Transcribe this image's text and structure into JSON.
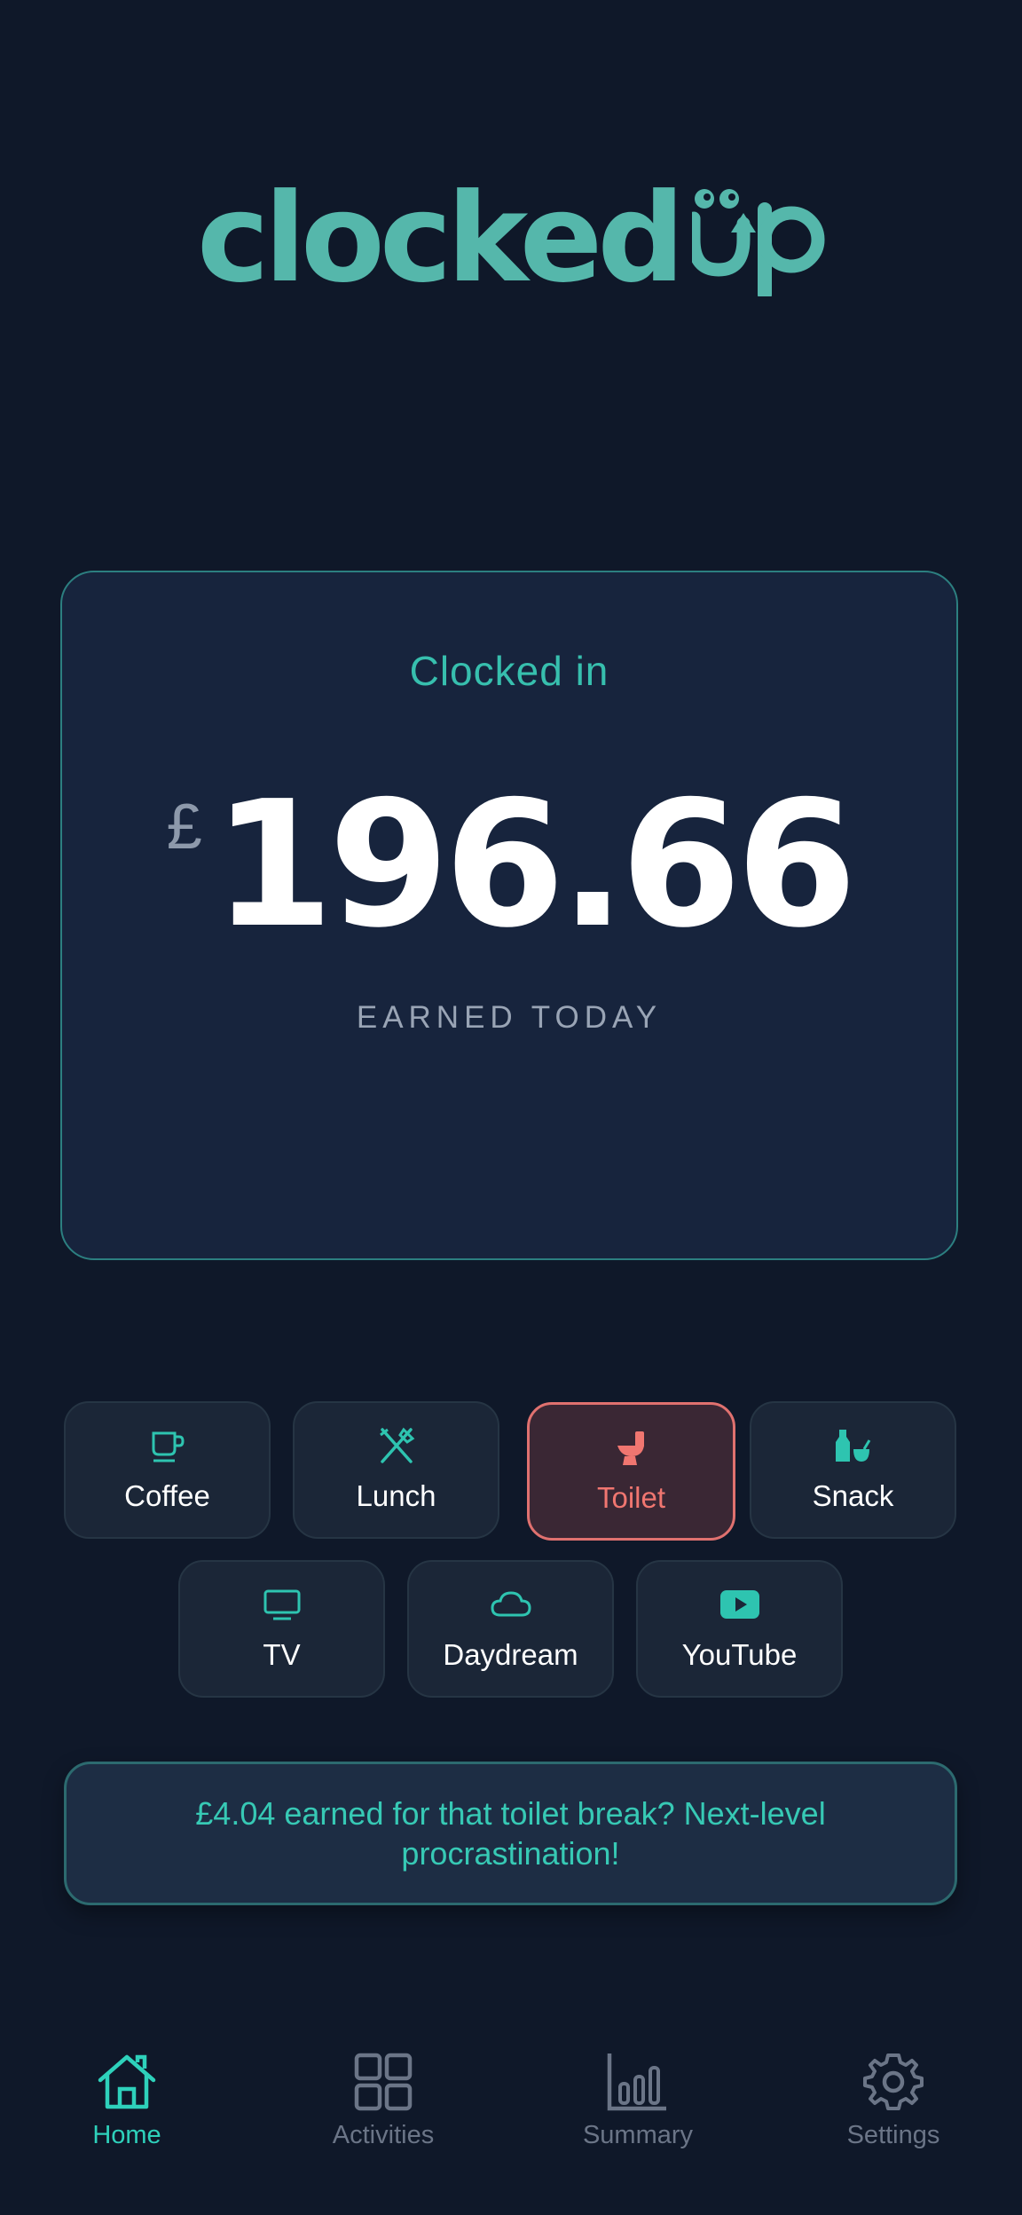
{
  "app": {
    "logo_text": "clocked",
    "logo_suffix": "up"
  },
  "colors": {
    "accent": "#37bfae",
    "brand_logo": "#55b7ab",
    "alert": "#e0716f",
    "background": "#0f1829",
    "card": "#17243d"
  },
  "status_card": {
    "status": "Clocked in",
    "currency": "£",
    "amount": "196.66",
    "label": "EARNED TODAY"
  },
  "activities": [
    {
      "label": "Coffee",
      "icon": "coffee-icon",
      "active": false
    },
    {
      "label": "Lunch",
      "icon": "utensils-icon",
      "active": false
    },
    {
      "label": "Toilet",
      "icon": "toilet-icon",
      "active": true
    },
    {
      "label": "Snack",
      "icon": "snack-icon",
      "active": false
    },
    {
      "label": "TV",
      "icon": "tv-icon",
      "active": false
    },
    {
      "label": "Daydream",
      "icon": "cloud-icon",
      "active": false
    },
    {
      "label": "YouTube",
      "icon": "youtube-icon",
      "active": false
    }
  ],
  "banner": {
    "message": "£4.04 earned for that toilet break? Next-level procrastination!"
  },
  "nav": [
    {
      "label": "Home",
      "icon": "home-icon",
      "active": true
    },
    {
      "label": "Activities",
      "icon": "grid-icon",
      "active": false
    },
    {
      "label": "Summary",
      "icon": "bar-chart-icon",
      "active": false
    },
    {
      "label": "Settings",
      "icon": "gear-icon",
      "active": false
    }
  ]
}
